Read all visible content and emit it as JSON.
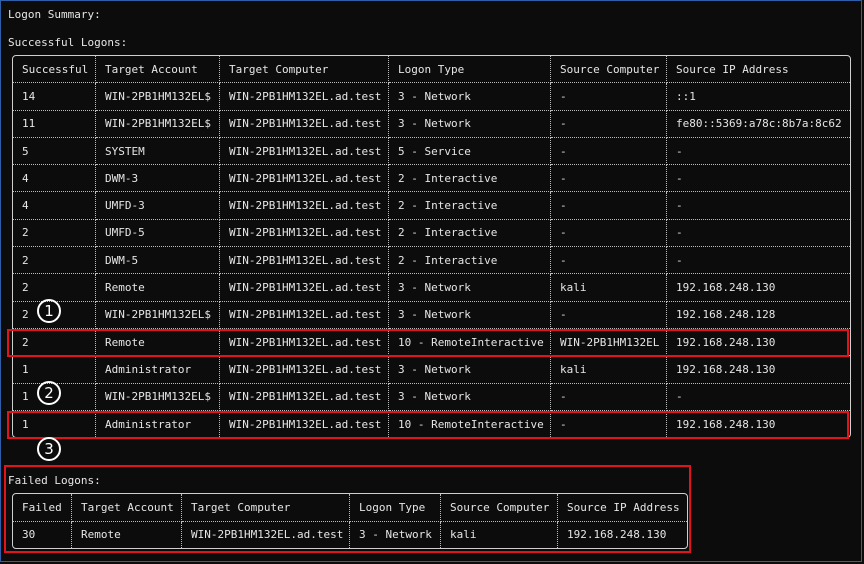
{
  "summary_title": "Logon Summary:",
  "successful": {
    "heading": "Successful Logons:",
    "columns": [
      "Successful",
      "Target Account",
      "Target Computer",
      "Logon Type",
      "Source Computer",
      "Source IP Address"
    ],
    "rows": [
      [
        "14",
        "WIN-2PB1HM132EL$",
        "WIN-2PB1HM132EL.ad.test",
        "3 - Network",
        "-",
        "::1"
      ],
      [
        "11",
        "WIN-2PB1HM132EL$",
        "WIN-2PB1HM132EL.ad.test",
        "3 - Network",
        "-",
        "fe80::5369:a78c:8b7a:8c62"
      ],
      [
        "5",
        "SYSTEM",
        "WIN-2PB1HM132EL.ad.test",
        "5 - Service",
        "-",
        "-"
      ],
      [
        "4",
        "DWM-3",
        "WIN-2PB1HM132EL.ad.test",
        "2 - Interactive",
        "-",
        "-"
      ],
      [
        "4",
        "UMFD-3",
        "WIN-2PB1HM132EL.ad.test",
        "2 - Interactive",
        "-",
        "-"
      ],
      [
        "2",
        "UMFD-5",
        "WIN-2PB1HM132EL.ad.test",
        "2 - Interactive",
        "-",
        "-"
      ],
      [
        "2",
        "DWM-5",
        "WIN-2PB1HM132EL.ad.test",
        "2 - Interactive",
        "-",
        "-"
      ],
      [
        "2",
        "Remote",
        "WIN-2PB1HM132EL.ad.test",
        "3 - Network",
        "kali",
        "192.168.248.130"
      ],
      [
        "2",
        "WIN-2PB1HM132EL$",
        "WIN-2PB1HM132EL.ad.test",
        "3 - Network",
        "-",
        "192.168.248.128"
      ],
      [
        "2",
        "Remote",
        "WIN-2PB1HM132EL.ad.test",
        "10 - RemoteInteractive",
        "WIN-2PB1HM132EL",
        "192.168.248.130"
      ],
      [
        "1",
        "Administrator",
        "WIN-2PB1HM132EL.ad.test",
        "3 - Network",
        "kali",
        "192.168.248.130"
      ],
      [
        "1",
        "WIN-2PB1HM132EL$",
        "WIN-2PB1HM132EL.ad.test",
        "3 - Network",
        "-",
        "-"
      ],
      [
        "1",
        "Administrator",
        "WIN-2PB1HM132EL.ad.test",
        "10 - RemoteInteractive",
        "-",
        "192.168.248.130"
      ]
    ]
  },
  "failed": {
    "heading": "Failed Logons:",
    "columns": [
      "Failed",
      "Target Account",
      "Target Computer",
      "Logon Type",
      "Source Computer",
      "Source IP Address"
    ],
    "rows": [
      [
        "30",
        "Remote",
        "WIN-2PB1HM132EL.ad.test",
        "3 - Network",
        "kali",
        "192.168.248.130"
      ]
    ]
  },
  "markers": [
    "1",
    "2",
    "3"
  ],
  "colors": {
    "background": "#0c0c0c",
    "text": "#e6e6e6",
    "highlight": "#e0141a",
    "marker": "#ffffff"
  }
}
